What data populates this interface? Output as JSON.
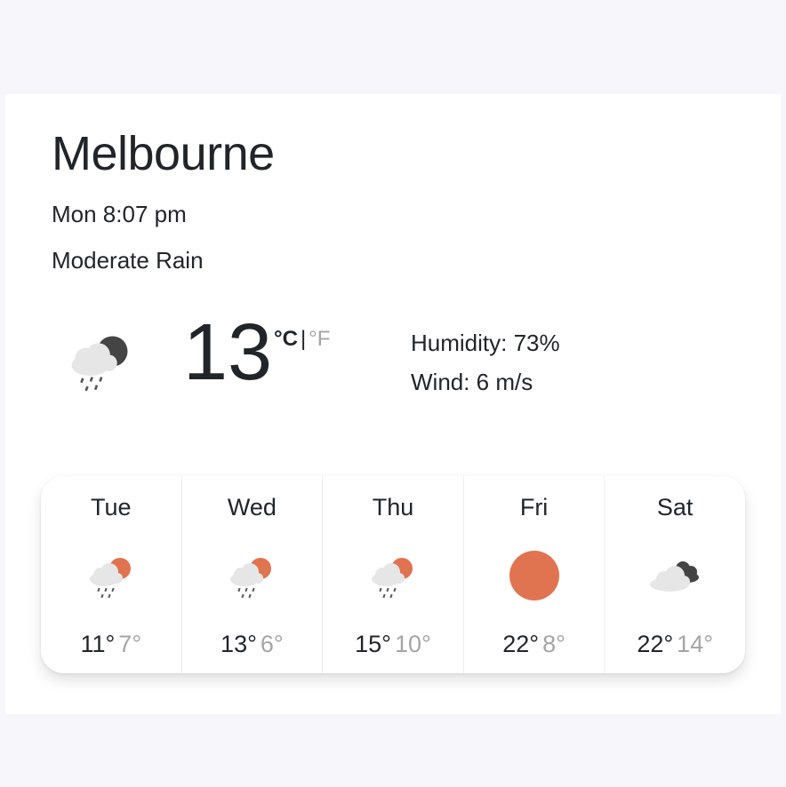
{
  "location": {
    "city": "Melbourne",
    "datetime": "Mon 8:07 pm",
    "description": "Moderate Rain"
  },
  "current": {
    "icon": "night-rain-icon",
    "temperature": "13",
    "unit_celsius": "°C",
    "unit_separator": "|",
    "unit_fahrenheit": "°F",
    "humidity": "Humidity: 73%",
    "wind": "Wind: 6 m/s"
  },
  "forecast": [
    {
      "day": "Tue",
      "icon": "day-rain-icon",
      "max": "11°",
      "min": "7°"
    },
    {
      "day": "Wed",
      "icon": "day-rain-icon",
      "max": "13°",
      "min": "6°"
    },
    {
      "day": "Thu",
      "icon": "day-rain-icon",
      "max": "15°",
      "min": "10°"
    },
    {
      "day": "Fri",
      "icon": "sun-icon",
      "max": "22°",
      "min": "8°"
    },
    {
      "day": "Sat",
      "icon": "broken-clouds-icon",
      "max": "22°",
      "min": "14°"
    }
  ],
  "colors": {
    "sun": "#e07450",
    "dark_cloud": "#444444",
    "light_cloud": "#e6e6e6",
    "muted_text": "#a5a5a5"
  }
}
